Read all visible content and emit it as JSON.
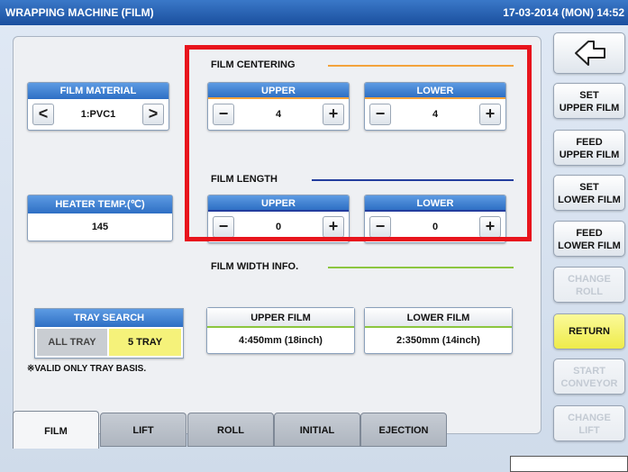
{
  "title": "WRAPPING MACHINE (FILM)",
  "clock": "17-03-2014 (MON)  14:52",
  "film_material": {
    "label": "FILM MATERIAL",
    "value": "1:PVC1",
    "prev": "<",
    "next": ">"
  },
  "heater_temp": {
    "label": "HEATER TEMP.(℃)",
    "value": "145"
  },
  "film_centering": {
    "label": "FILM CENTERING",
    "upper": {
      "label": "UPPER",
      "value": "4",
      "minus": "−",
      "plus": "+"
    },
    "lower": {
      "label": "LOWER",
      "value": "4",
      "minus": "−",
      "plus": "+"
    }
  },
  "film_length": {
    "label": "FILM LENGTH",
    "upper": {
      "label": "UPPER",
      "value": "0",
      "minus": "−",
      "plus": "+"
    },
    "lower": {
      "label": "LOWER",
      "value": "0",
      "minus": "−",
      "plus": "+"
    }
  },
  "film_width": {
    "label": "FILM WIDTH INFO.",
    "upper": {
      "label": "UPPER FILM",
      "value": "4:450mm (18inch)"
    },
    "lower": {
      "label": "LOWER FILM",
      "value": "2:350mm (14inch)"
    }
  },
  "tray_search": {
    "label": "TRAY SEARCH",
    "opt_all": "ALL TRAY",
    "opt_five": "5 TRAY",
    "selected": "5 TRAY"
  },
  "note": "※VALID ONLY TRAY BASIS.",
  "tabs": [
    "FILM",
    "LIFT",
    "ROLL",
    "INITIAL",
    "EJECTION"
  ],
  "active_tab": "FILM",
  "side": {
    "back_icon": "return-arrow-icon",
    "set_upper": [
      "SET",
      "UPPER FILM"
    ],
    "feed_upper": [
      "FEED",
      "UPPER FILM"
    ],
    "set_lower": [
      "SET",
      "LOWER FILM"
    ],
    "feed_lower": [
      "FEED",
      "LOWER FILM"
    ],
    "change_roll": [
      "CHANGE",
      "ROLL"
    ],
    "return": "RETURN",
    "start_conveyor": [
      "START",
      "CONVEYOR"
    ],
    "change_lift": [
      "CHANGE",
      "LIFT"
    ]
  },
  "colors": {
    "title_blue": "#1a4f9e",
    "highlight_red": "#e8141c",
    "centering_line": "#f3a33c",
    "length_line": "#233d9e",
    "width_line": "#8cc63f",
    "selected_yellow": "#f5f27a"
  }
}
